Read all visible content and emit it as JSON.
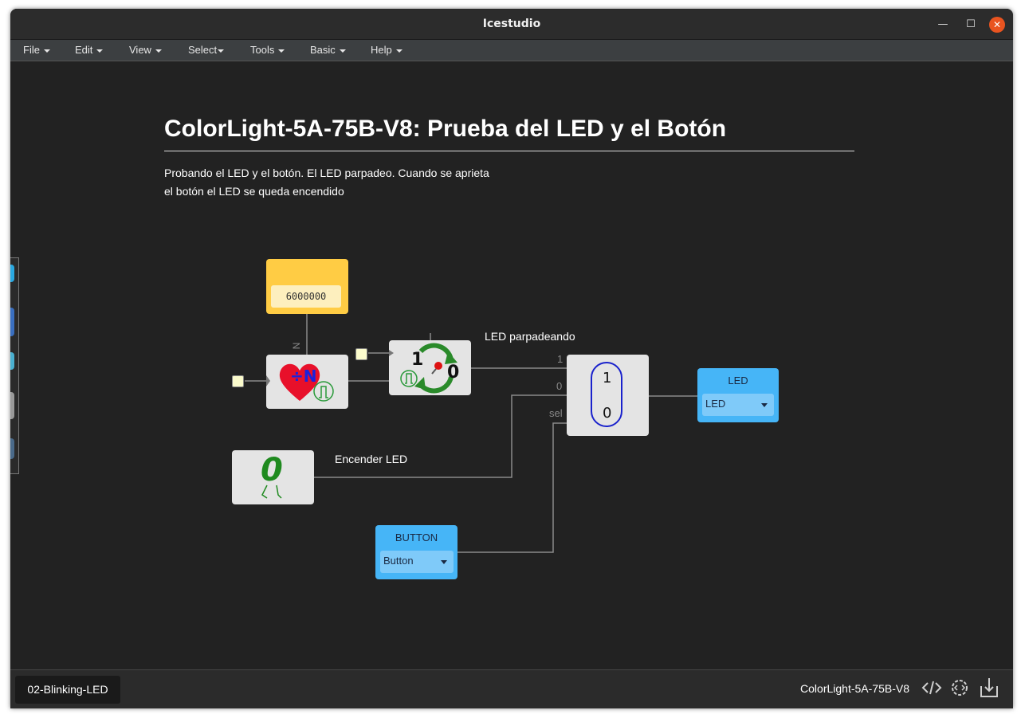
{
  "window": {
    "title": "Icestudio"
  },
  "menu": [
    {
      "label": "File"
    },
    {
      "label": "Edit"
    },
    {
      "label": "View"
    },
    {
      "label": "Select"
    },
    {
      "label": "Tools"
    },
    {
      "label": "Basic"
    },
    {
      "label": "Help"
    }
  ],
  "doc": {
    "title": "ColorLight-5A-75B-V8: Prueba del LED y el Botón",
    "desc_line1": "Probando el LED y el botón. El LED parpadeo. Cuando se aprieta",
    "desc_line2": "el botón el LED se queda encendido"
  },
  "circuit": {
    "constant_value": "6000000",
    "param_label": "N",
    "divider_text": "÷N",
    "toggle_one": "1",
    "toggle_zero": "0",
    "mux_one": "1",
    "mux_zero": "0",
    "zero_const": "0",
    "wire_label_blink": "LED parpadeando",
    "wire_label_on": "Encender LED",
    "port_1": "1",
    "port_0": "0",
    "port_sel": "sel",
    "led_block": {
      "title": "LED",
      "value": "LED"
    },
    "button_block": {
      "title": "BUTTON",
      "value": "Button"
    }
  },
  "status": {
    "tab": "02-Blinking-LED",
    "board": "ColorLight-5A-75B-V8"
  },
  "colors": {
    "accent_blue": "#46b5f7",
    "constant_yellow": "#ffcc44",
    "close": "#e95420",
    "canvas": "#222222"
  },
  "icons": [
    "minimize-icon",
    "maximize-icon",
    "close-icon",
    "heart-icon",
    "pulse-icon",
    "pushpin-icon",
    "cycle-arrows-icon",
    "code-icon",
    "gear-code-icon",
    "download-icon"
  ]
}
